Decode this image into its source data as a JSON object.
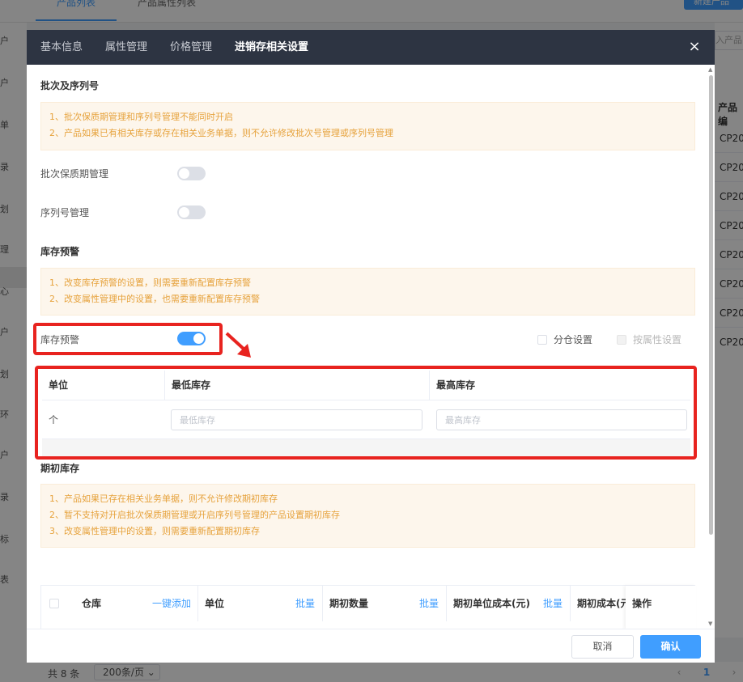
{
  "background": {
    "tabs": [
      "产品列表",
      "产品属性列表"
    ],
    "new_button": "新建产品",
    "search_placeholder": "入产品",
    "nav_chars": [
      "户",
      "户",
      "单",
      "录",
      "划",
      "理",
      "心",
      "户",
      "划",
      "环",
      "户",
      "录",
      "标",
      "表"
    ],
    "column_header": "产品编",
    "codes": [
      "CP20",
      "CP20",
      "CP20",
      "CP20",
      "CP20",
      "CP20",
      "CP20",
      "CP20"
    ],
    "footer": {
      "total": "共 8 条",
      "page_size": "200条/页",
      "page": "1"
    }
  },
  "dialog": {
    "tabs": [
      "基本信息",
      "属性管理",
      "价格管理",
      "进销存相关设置"
    ],
    "active_tab": 3,
    "close_icon": "×",
    "batch_section": {
      "title": "批次及序列号",
      "notices": [
        "1、批次保质期管理和序列号管理不能同时开启",
        "2、产品如果已有相关库存或存在相关业务单据，则不允许修改批次号管理或序列号管理"
      ],
      "batch_label": "批次保质期管理",
      "batch_enabled": false,
      "serial_label": "序列号管理",
      "serial_enabled": false
    },
    "warning_section": {
      "title": "库存预警",
      "notices": [
        "1、改变库存预警的设置，则需要重新配置库存预警",
        "2、改变属性管理中的设置，也需要重新配置库存预警"
      ],
      "toggle_label": "库存预警",
      "toggle_enabled": true,
      "by_warehouse_label": "分仓设置",
      "by_attribute_label": "按属性设置",
      "table": {
        "headers": [
          "单位",
          "最低库存",
          "最高库存"
        ],
        "rows": [
          {
            "unit": "个",
            "min_placeholder": "最低库存",
            "max_placeholder": "最高库存"
          }
        ]
      }
    },
    "initial_section": {
      "title": "期初库存",
      "notices": [
        "1、产品如果已存在相关业务单据，则不允许修改期初库存",
        "2、暂不支持对开启批次保质期管理或开启序列号管理的产品设置期初库存",
        "3、改变属性管理中的设置，则需要重新配置期初库存"
      ],
      "table": {
        "headers": [
          "仓库",
          "单位",
          "期初数量",
          "期初单位成本(元)",
          "期初成本(元)",
          "操作"
        ],
        "links": [
          "一键添加",
          "批量",
          "批量",
          "批量"
        ]
      }
    },
    "footer": {
      "cancel": "取消",
      "confirm": "确认"
    }
  },
  "colors": {
    "primary": "#409eff",
    "header_bg": "#2d3442",
    "notice_bg": "#fdf6ec",
    "notice_text": "#e6a23c",
    "highlight": "#e8231f"
  }
}
